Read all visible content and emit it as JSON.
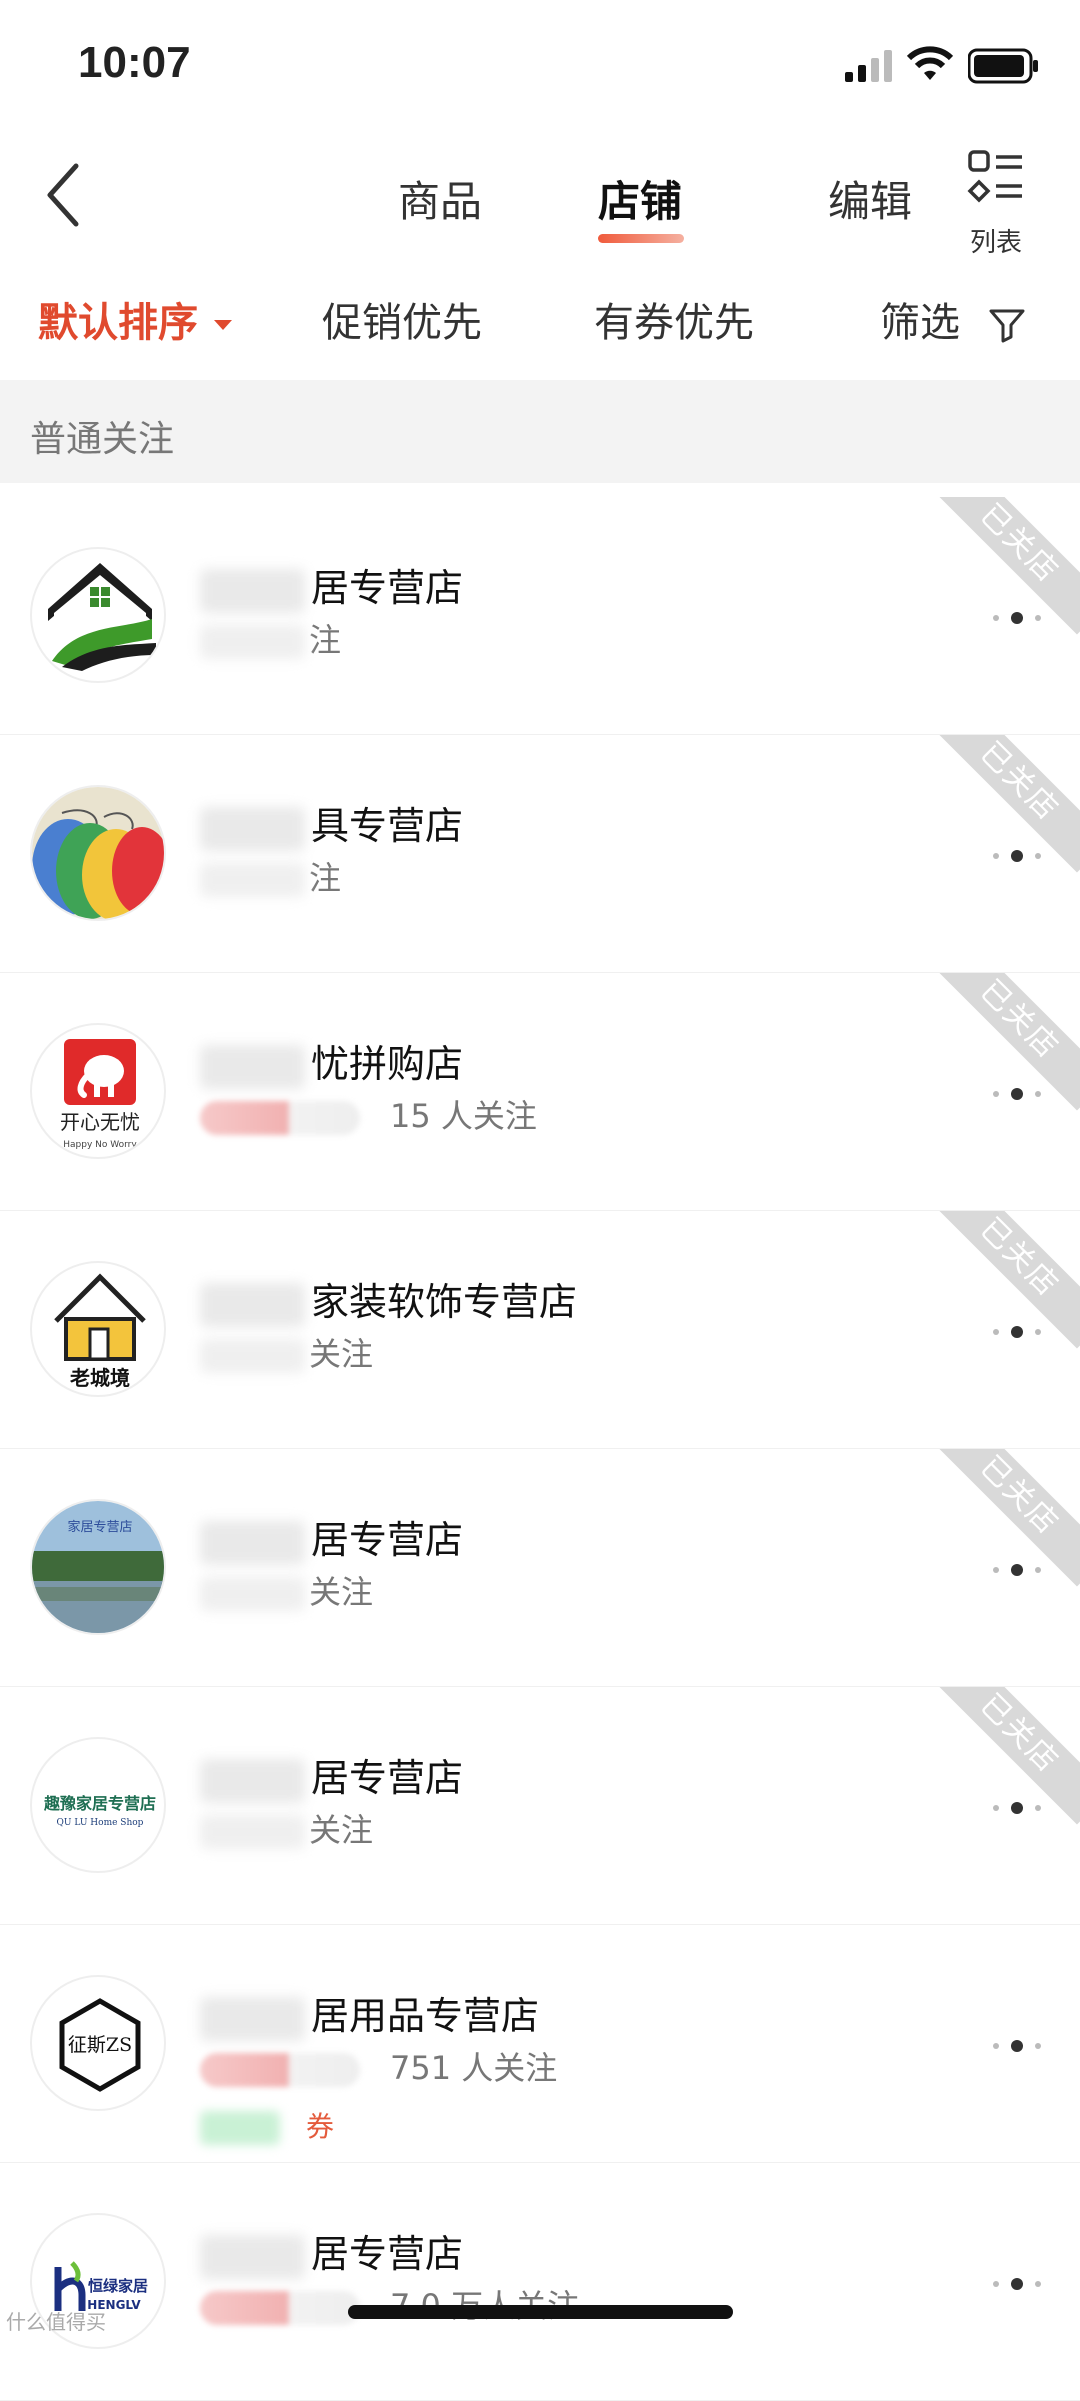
{
  "status_bar": {
    "time": "10:07"
  },
  "nav": {
    "tabs": [
      {
        "label": "商品",
        "active": false
      },
      {
        "label": "店铺",
        "active": true
      },
      {
        "label": "编辑",
        "active": false
      }
    ],
    "list_toggle_label": "列表"
  },
  "filters": {
    "items": [
      {
        "label": "默认排序",
        "active": true
      },
      {
        "label": "促销优先",
        "active": false
      },
      {
        "label": "有券优先",
        "active": false
      },
      {
        "label": "筛选",
        "active": false
      }
    ]
  },
  "section": {
    "title": "普通关注"
  },
  "ribbon_label": "已关店",
  "shops": [
    {
      "name_visible": "居专营店",
      "sub_visible": "注",
      "has_stars": false,
      "has_coupon": false,
      "closed": true
    },
    {
      "name_visible": "具专营店",
      "sub_visible": "注",
      "has_stars": false,
      "has_coupon": false,
      "closed": true
    },
    {
      "name_visible": "忧拼购店",
      "sub_visible": "15 人关注",
      "has_stars": true,
      "has_coupon": false,
      "closed": true
    },
    {
      "name_visible": "家装软饰专营店",
      "sub_visible": "关注",
      "has_stars": false,
      "has_coupon": false,
      "closed": true
    },
    {
      "name_visible": "居专营店",
      "sub_visible": "关注",
      "has_stars": false,
      "has_coupon": false,
      "closed": true
    },
    {
      "name_visible": "居专营店",
      "sub_visible": "关注",
      "has_stars": false,
      "has_coupon": false,
      "closed": true
    },
    {
      "name_visible": "居用品专营店",
      "sub_visible": "751 人关注",
      "has_stars": true,
      "has_coupon": true,
      "coupon_label": "券",
      "closed": false
    },
    {
      "name_visible": "居专营店",
      "sub_visible": "7.0 万人关注",
      "has_stars": true,
      "has_coupon": false,
      "closed": false
    }
  ],
  "logos": {
    "kaixin": {
      "cn": "开心无忧",
      "en": "Happy No Worry"
    },
    "laochengjing": {
      "cn": "老城境"
    },
    "lake": {
      "cn": "家居专营店"
    },
    "quyu": {
      "cn": "趣豫家居专营店",
      "en": "QU LU Home Shop"
    },
    "zhengsi": {
      "cn": "征斯ZS"
    },
    "henglv": {
      "cn": "恒绿家居",
      "en": "HENGLV"
    }
  },
  "watermark": "什么值得买"
}
